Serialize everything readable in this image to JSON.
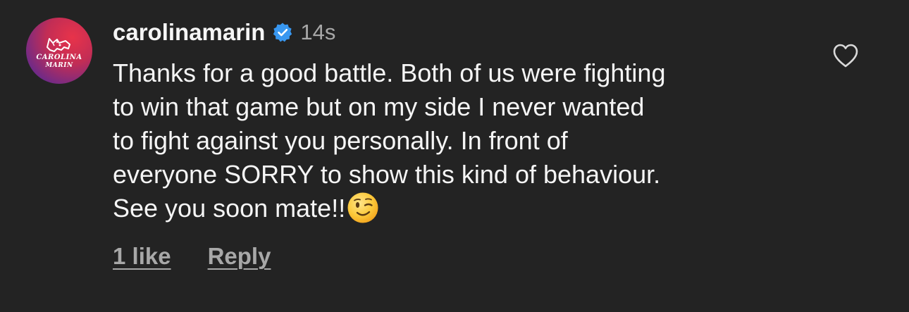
{
  "comment": {
    "avatar": {
      "icon": "lynx-logo",
      "text_line1": "CAROLINA",
      "text_line2": "MARIN",
      "accent_colors": [
        "#e8334a",
        "#6b2a8a"
      ]
    },
    "username": "carolinamarin",
    "verified_icon": "verified-badge-icon",
    "verified_color": "#3897f0",
    "time": "14s",
    "text_lines": [
      "Thanks for a good battle. Both of us were fighting",
      "to win that game but on my side I never wanted",
      "to fight against you personally. In front of",
      "everyone SORRY to show this kind of behaviour.",
      "See you soon mate!!"
    ],
    "emoji": "winking-face-emoji",
    "likes_label": "1 like",
    "reply_label": "Reply",
    "like_icon": "heart-outline-icon"
  }
}
